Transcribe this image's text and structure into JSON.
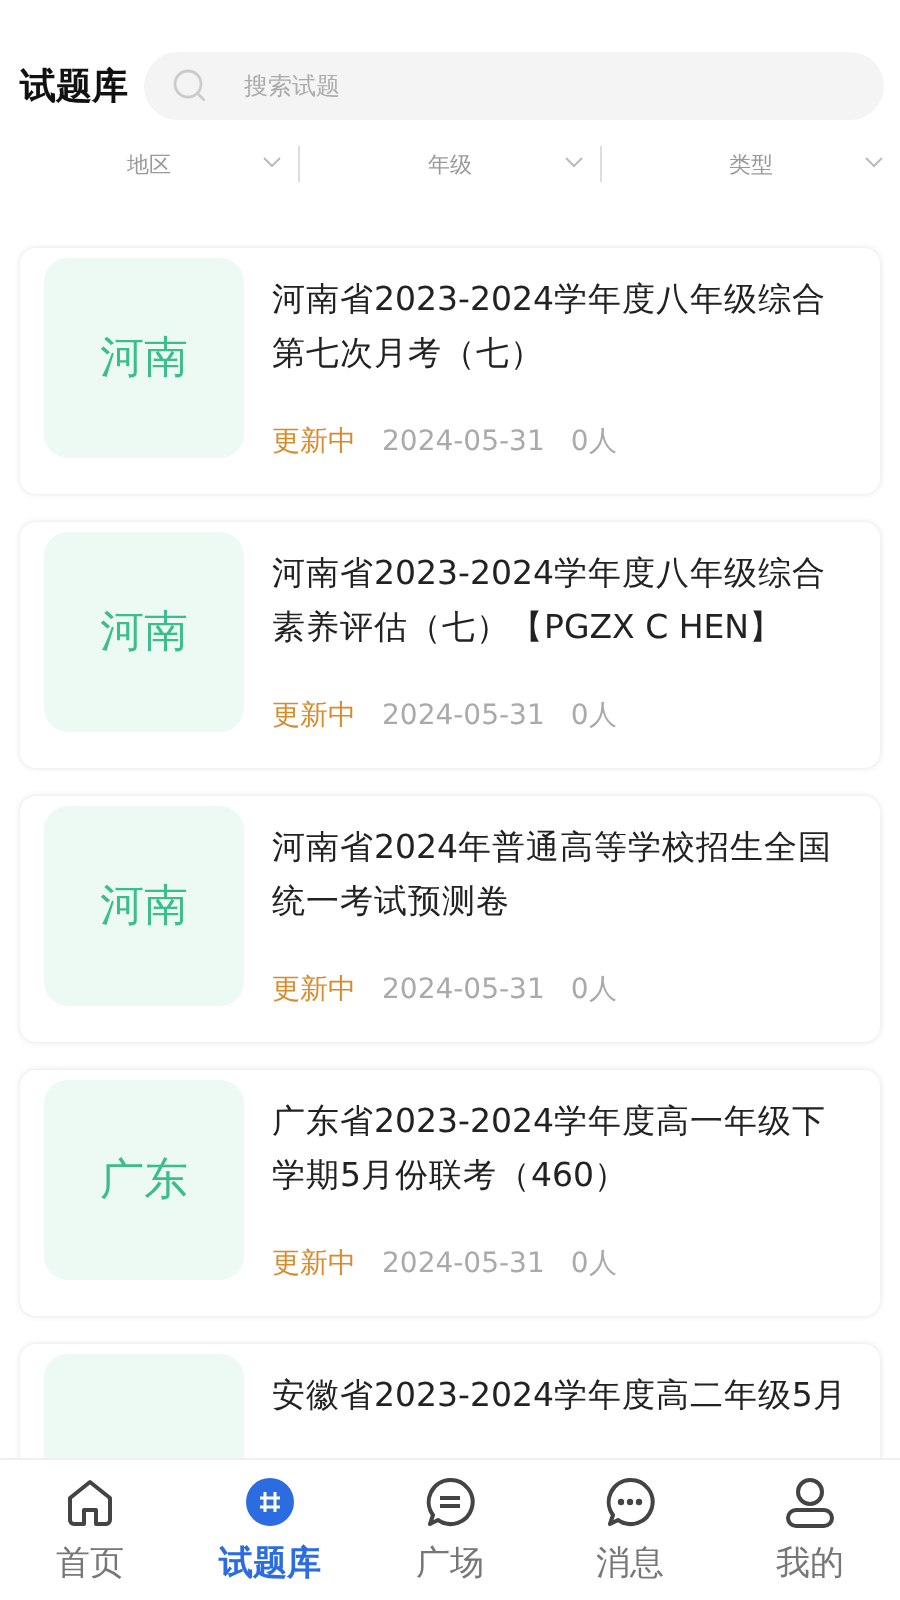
{
  "header": {
    "title": "试题库",
    "search": {
      "placeholder": "搜索试题"
    }
  },
  "filters": [
    {
      "label": "地区"
    },
    {
      "label": "年级"
    },
    {
      "label": "类型"
    }
  ],
  "papers": [
    {
      "region": "河南",
      "title": "河南省2023-2024学年度八年级综合第七次月考（七）",
      "status": "更新中",
      "date": "2024-05-31",
      "count": "0人"
    },
    {
      "region": "河南",
      "title": "河南省2023-2024学年度八年级综合素养评估（七）【PGZX C HEN】",
      "status": "更新中",
      "date": "2024-05-31",
      "count": "0人"
    },
    {
      "region": "河南",
      "title": "河南省2024年普通高等学校招生全国统一考试预测卷",
      "status": "更新中",
      "date": "2024-05-31",
      "count": "0人"
    },
    {
      "region": "广东",
      "title": "广东省2023-2024学年度高一年级下学期5月份联考（460）",
      "status": "更新中",
      "date": "2024-05-31",
      "count": "0人"
    },
    {
      "title": "安徽省2023-2024学年度高二年级5月"
    }
  ],
  "tab_bar": [
    {
      "label": "首页",
      "selected": false
    },
    {
      "label": "试题库",
      "selected": true
    },
    {
      "label": "广场",
      "selected": false
    },
    {
      "label": "消息",
      "selected": false
    },
    {
      "label": "我的",
      "selected": false
    }
  ]
}
